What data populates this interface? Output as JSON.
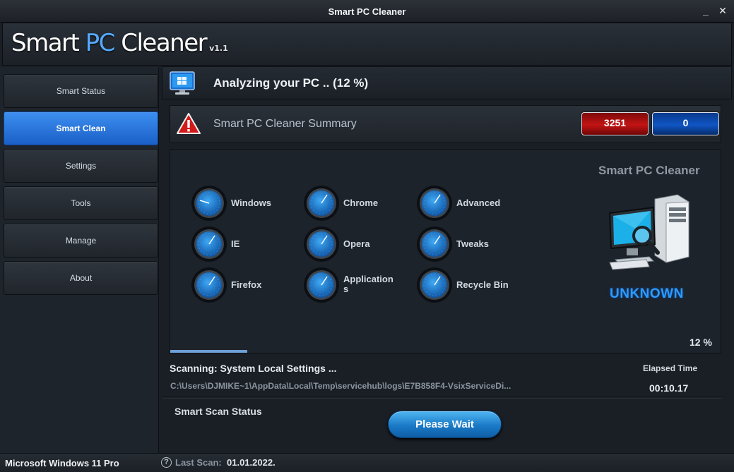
{
  "window": {
    "title": "Smart PC Cleaner",
    "minimize": "_",
    "close": "✕"
  },
  "header": {
    "logo_part1": "Smart ",
    "logo_part2": "PC",
    "logo_part3": " Cleaner",
    "version": "v1.1"
  },
  "sidebar": {
    "items": [
      {
        "label": "Smart Status",
        "active": false
      },
      {
        "label": "Smart Clean",
        "active": true
      },
      {
        "label": "Settings",
        "active": false
      },
      {
        "label": "Tools",
        "active": false
      },
      {
        "label": "Manage",
        "active": false
      },
      {
        "label": "About",
        "active": false
      }
    ]
  },
  "analyze": {
    "text": "Analyzing your PC ..  (12 %)",
    "icon": "monitor-icon"
  },
  "summary": {
    "title": "Smart PC Cleaner Summary",
    "icon": "warning-icon",
    "issues_count": "3251",
    "fixed_count": "0",
    "colors": {
      "issues": "#c31414",
      "fixed": "#1055c4"
    }
  },
  "scan_items": [
    {
      "label": "Windows"
    },
    {
      "label": "Chrome"
    },
    {
      "label": "Advanced"
    },
    {
      "label": "IE"
    },
    {
      "label": "Opera"
    },
    {
      "label": "Tweaks"
    },
    {
      "label": "Firefox"
    },
    {
      "label": "Application\ns"
    },
    {
      "label": "Recycle Bin"
    }
  ],
  "brand": {
    "name": "Smart PC Cleaner",
    "status": "UNKNOWN",
    "status_color": "#2d9bff"
  },
  "progress": {
    "percent_label": "12 %",
    "value": 0.14
  },
  "scan": {
    "current": "Scanning: System Local Settings ...",
    "path": "C:\\Users\\DJMIKE~1\\AppData\\Local\\Temp\\servicehub\\logs\\E7B858F4-VsixServiceDi...",
    "elapsed_label": "Elapsed Time",
    "elapsed_value": "00:10.17"
  },
  "status": {
    "title": "Smart Scan Status",
    "button_label": "Please Wait"
  },
  "footer": {
    "os": "Microsoft Windows 11 Pro",
    "help_icon": "?",
    "last_scan_label": "Last Scan:",
    "last_scan_value": "01.01.2022."
  },
  "accent_color": "#3d8ff0"
}
